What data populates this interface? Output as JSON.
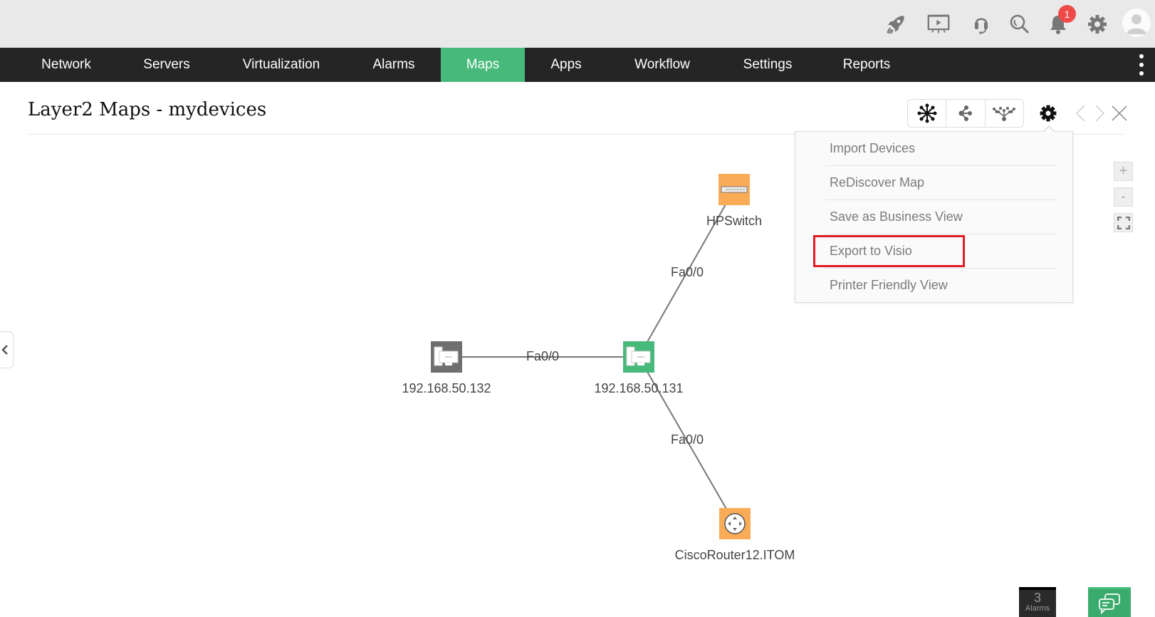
{
  "topbar": {
    "icons": [
      "rocket-icon",
      "presentation-icon",
      "support-headset-icon",
      "search-icon",
      "notification-bell-icon",
      "settings-gear-icon",
      "user-avatar-icon"
    ],
    "notification_count": "1"
  },
  "nav": {
    "items": [
      {
        "label": "Network"
      },
      {
        "label": "Servers"
      },
      {
        "label": "Virtualization"
      },
      {
        "label": "Alarms"
      },
      {
        "label": "Maps",
        "active": true
      },
      {
        "label": "Apps"
      },
      {
        "label": "Workflow"
      },
      {
        "label": "Settings"
      },
      {
        "label": "Reports"
      }
    ],
    "active_color": "#47b97a"
  },
  "page": {
    "title": "Layer2 Maps - mydevices"
  },
  "toolbar": {
    "layouts": [
      "star-layout-icon",
      "tree-layout-icon",
      "hierarchical-layout-icon"
    ]
  },
  "settings_menu": {
    "items": [
      {
        "label": "Import Devices"
      },
      {
        "label": "ReDiscover Map"
      },
      {
        "label": "Save as Business View"
      },
      {
        "label": "Export to Visio",
        "highlighted": true
      },
      {
        "label": "Printer Friendly View"
      }
    ]
  },
  "zoom_controls": {
    "zoom_in": "+",
    "zoom_out": "-"
  },
  "map": {
    "nodes": [
      {
        "id": "n132",
        "label": "192.168.50.132",
        "type": "server",
        "color": "#6f6f6f"
      },
      {
        "id": "n131",
        "label": "192.168.50.131",
        "type": "server",
        "color": "#47b97a"
      },
      {
        "id": "hpswitch",
        "label": "HPSwitch",
        "type": "switch",
        "color": "#f9ab57"
      },
      {
        "id": "router",
        "label": "CiscoRouter12.ITOM",
        "type": "router",
        "color": "#f9ab57"
      }
    ],
    "links": [
      {
        "from": "n132",
        "to": "n131",
        "label": "Fa0/0"
      },
      {
        "from": "n131",
        "to": "hpswitch",
        "label": "Fa0/0"
      },
      {
        "from": "n131",
        "to": "router",
        "label": "Fa0/0"
      }
    ]
  },
  "footer": {
    "alarm_count": "3",
    "alarm_label": "Alarms"
  }
}
